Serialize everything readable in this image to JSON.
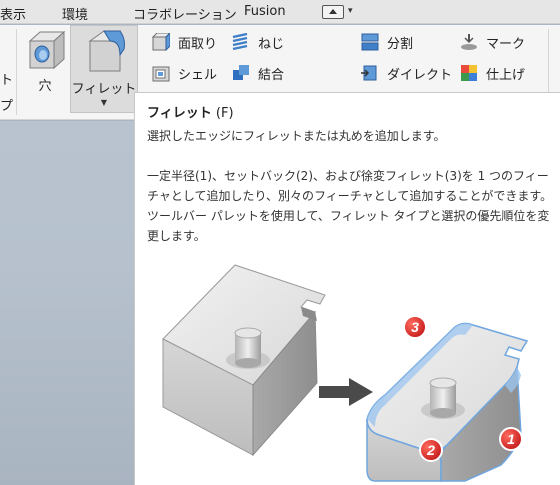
{
  "menu": {
    "items": [
      "表示",
      "環境",
      "コラボレーション",
      "Fusion"
    ]
  },
  "ribbon": {
    "cut_left_top": "ト",
    "cut_left_bottom": "プ",
    "hole_label": "穴",
    "fillet_label": "フィレット",
    "small_buttons": [
      {
        "label": "面取り",
        "icon": "chamfer-icon"
      },
      {
        "label": "シェル",
        "icon": "shell-icon"
      },
      {
        "label": "ねじ",
        "icon": "thread-icon"
      },
      {
        "label": "結合",
        "icon": "combine-icon"
      },
      {
        "label": "分割",
        "icon": "split-icon"
      },
      {
        "label": "ダイレクト",
        "icon": "direct-edit-icon"
      },
      {
        "label": "マーク",
        "icon": "mark-icon"
      },
      {
        "label": "仕上げ",
        "icon": "appearance-icon"
      }
    ]
  },
  "tooltip": {
    "title": "フィレット",
    "shortcut": "(F)",
    "line1": "選択したエッジにフィレットまたは丸めを追加します。",
    "para2_line1": "一定半径(1)、セットバック(2)、および徐変フィレット(3)を 1 つのフィー",
    "para2_line2": "チャとして追加したり、別々のフィーチャとして追加することができます。",
    "para2_line3": "ツールバー パレットを使用して、フィレット タイプと選択の優先順位を変",
    "para2_line4": "更します。",
    "badges": [
      "3",
      "2",
      "1"
    ]
  },
  "colors": {
    "accent_blue": "#6fa6e0",
    "badge_red": "#d62222",
    "ribbon_bg": "#f5f5f5",
    "canvas": "#b4bfcb"
  }
}
